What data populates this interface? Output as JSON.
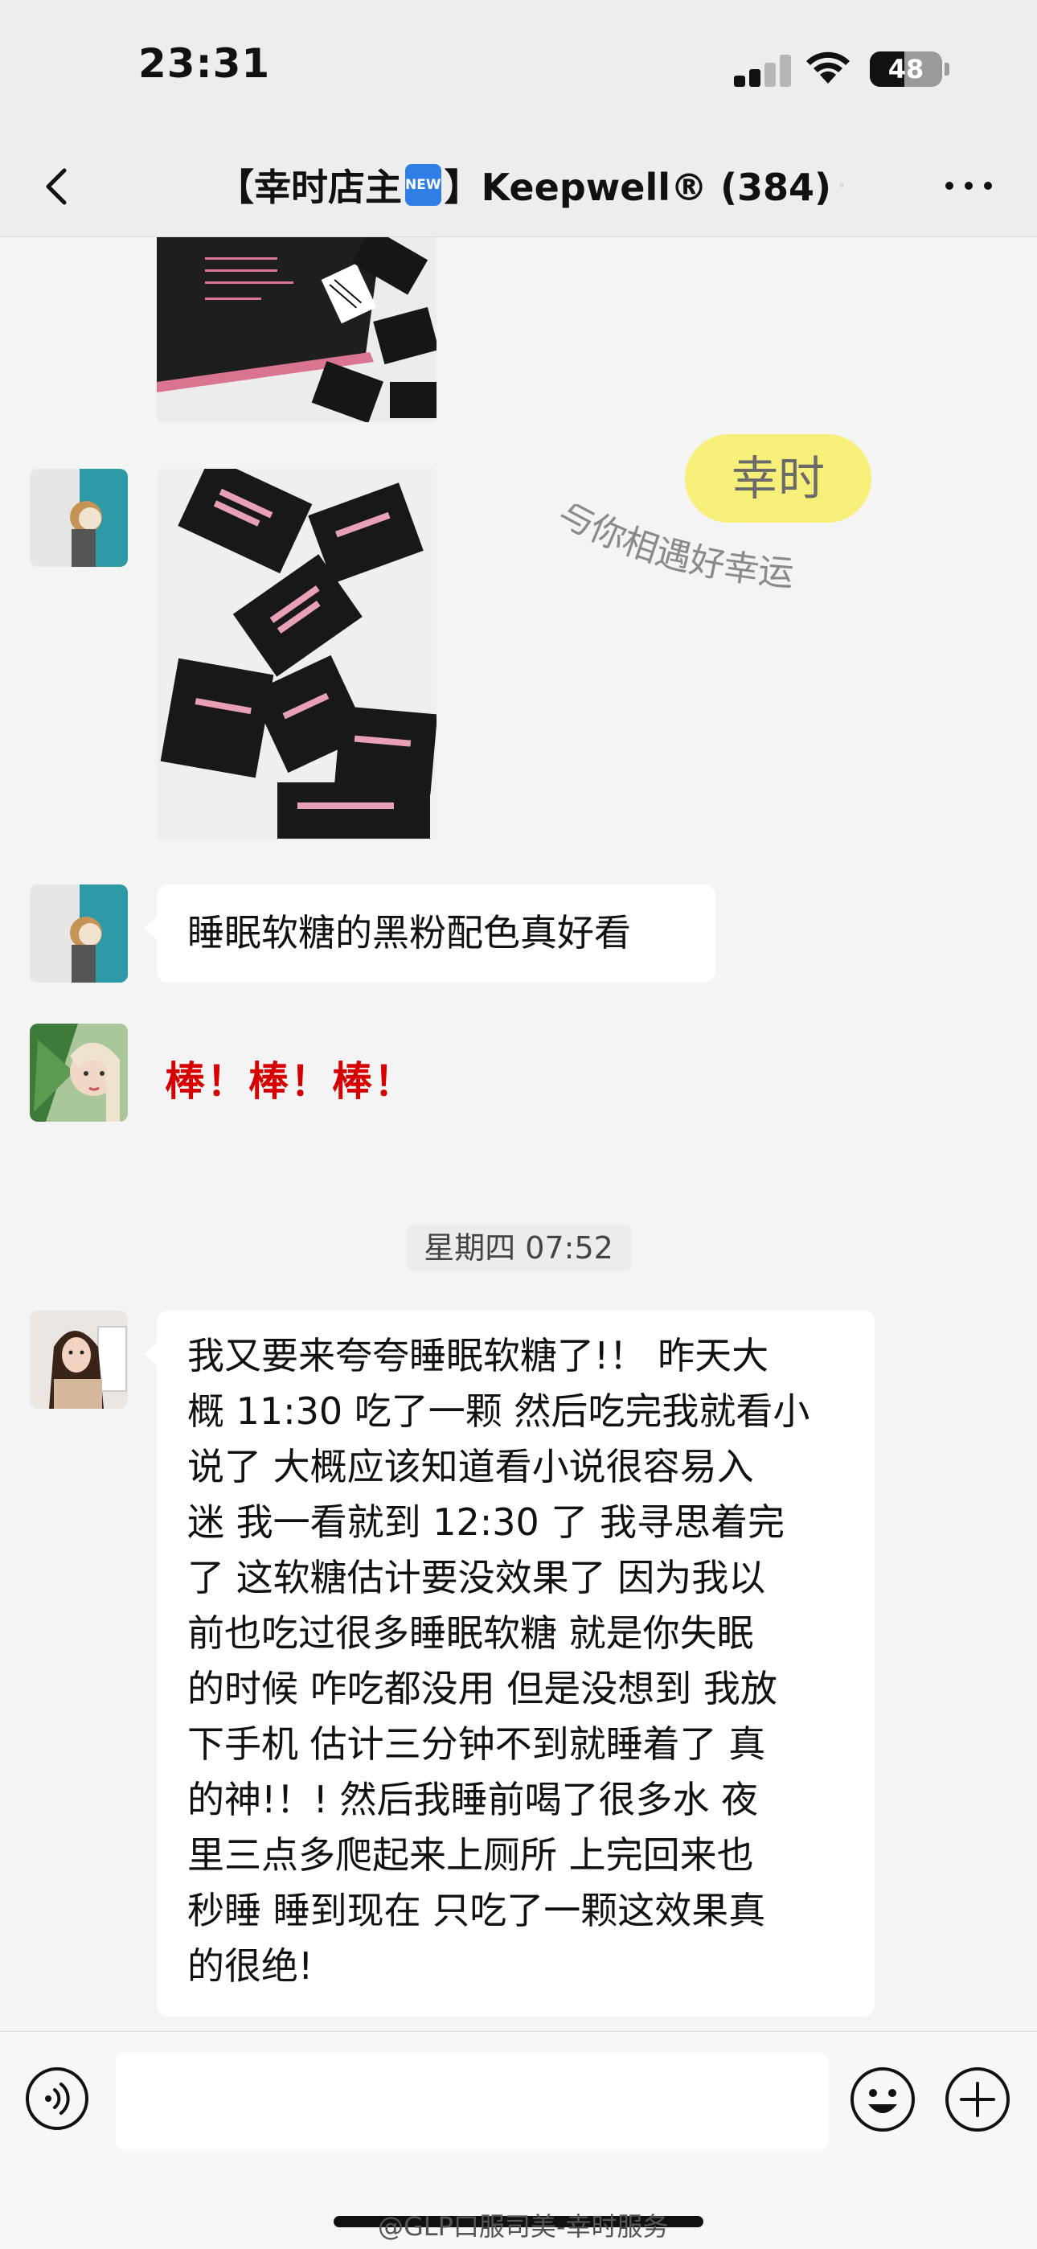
{
  "status_bar": {
    "time": "23:31",
    "battery": "48",
    "battery_level": 0.48
  },
  "nav": {
    "title_prefix": "【幸时店主",
    "new_badge": "NEW",
    "title_suffix": "】Keepwell® (384)",
    "icons": {
      "back": "chevron-left-icon",
      "mute": "bell-slash-icon",
      "more": "more-dots-icon"
    }
  },
  "watermark": {
    "badge": "幸时",
    "slogan": "与你相遇好幸运",
    "badge_color": "#f6f07a"
  },
  "messages": [
    {
      "type": "image",
      "sender": "user",
      "description_icon": "photo-icon"
    },
    {
      "type": "image",
      "sender": "user",
      "description_icon": "photo-icon"
    },
    {
      "type": "text",
      "sender": "user",
      "text": "睡眠软糖的黑粉配色真好看"
    },
    {
      "type": "text",
      "sender": "user",
      "text": "棒！棒！棒！",
      "color": "#d60000"
    },
    {
      "type": "timestamp",
      "text": "星期四 07:52"
    },
    {
      "type": "text",
      "sender": "user",
      "lines": [
        "我又要来夸夸睡眠软糖了!！ 昨天大",
        "概 11:30 吃了一颗 然后吃完我就看小",
        "说了 大概应该知道看小说很容易入",
        "迷 我一看就到 12:30 了 我寻思着完",
        "了 这软糖估计要没效果了 因为我以",
        "前也吃过很多睡眠软糖 就是你失眠",
        "的时候 咋吃都没用 但是没想到 我放",
        "下手机 估计三分钟不到就睡着了 真",
        "的神!！! 然后我睡前喝了很多水 夜",
        "里三点多爬起来上厕所 上完回来也",
        "秒睡 睡到现在 只吃了一颗这效果真",
        "的很绝!"
      ]
    }
  ],
  "input_bar": {
    "placeholder": "",
    "icons": {
      "voice": "voice-icon",
      "emoji": "smiley-icon",
      "plus": "plus-icon"
    }
  },
  "footer": {
    "watermark_text": "@GLP口服司美-幸时服务"
  },
  "colors": {
    "accent_red": "#d60000",
    "bubble": "#ffffff",
    "background": "#f4f4f4"
  }
}
